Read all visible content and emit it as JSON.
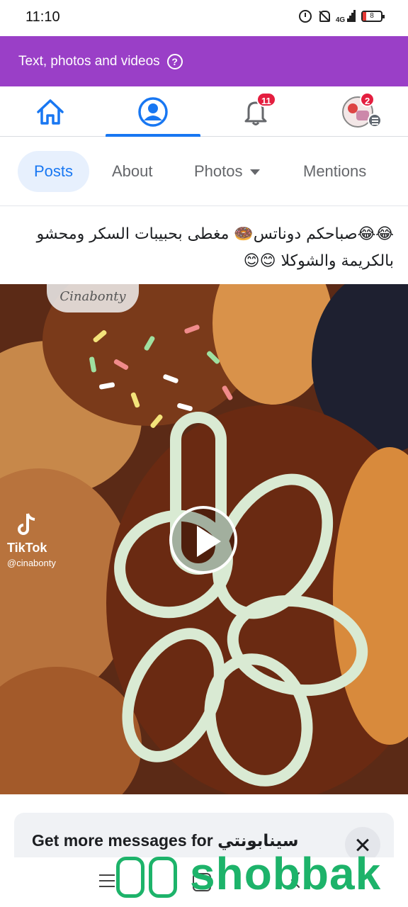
{
  "status_bar": {
    "time": "11:10",
    "network": "4G",
    "battery": "8"
  },
  "banner": {
    "text": "Text, photos and videos",
    "help_icon": "question-circle-icon"
  },
  "top_nav": {
    "items": [
      {
        "name": "home",
        "icon": "home-icon"
      },
      {
        "name": "profile",
        "icon": "profile-icon",
        "active": true
      },
      {
        "name": "notifications",
        "icon": "bell-icon",
        "badge": "11"
      },
      {
        "name": "menu",
        "icon": "avatar",
        "badge": "2"
      }
    ],
    "accent": "#1877f2",
    "badge_color": "#e41e3f"
  },
  "tabs": [
    {
      "label": "Posts",
      "active": true
    },
    {
      "label": "About"
    },
    {
      "label": "Photos",
      "has_dropdown": true
    },
    {
      "label": "Mentions"
    }
  ],
  "post": {
    "text": "😂😂صباحكم دوناتس🍩 مغطى بحبيبات السكر ومحشو بالكريمة والشوكلا 😊😊"
  },
  "video": {
    "watermark_brand": "TikTok",
    "watermark_user": "@cinabonty",
    "brand_tag": "Cinabonty"
  },
  "message_card": {
    "text": "Get more messages for سينابونتي"
  },
  "watermark": {
    "brand": "shobbak",
    "color": "#1db36a"
  },
  "colors": {
    "banner": "#9a3fc7"
  }
}
